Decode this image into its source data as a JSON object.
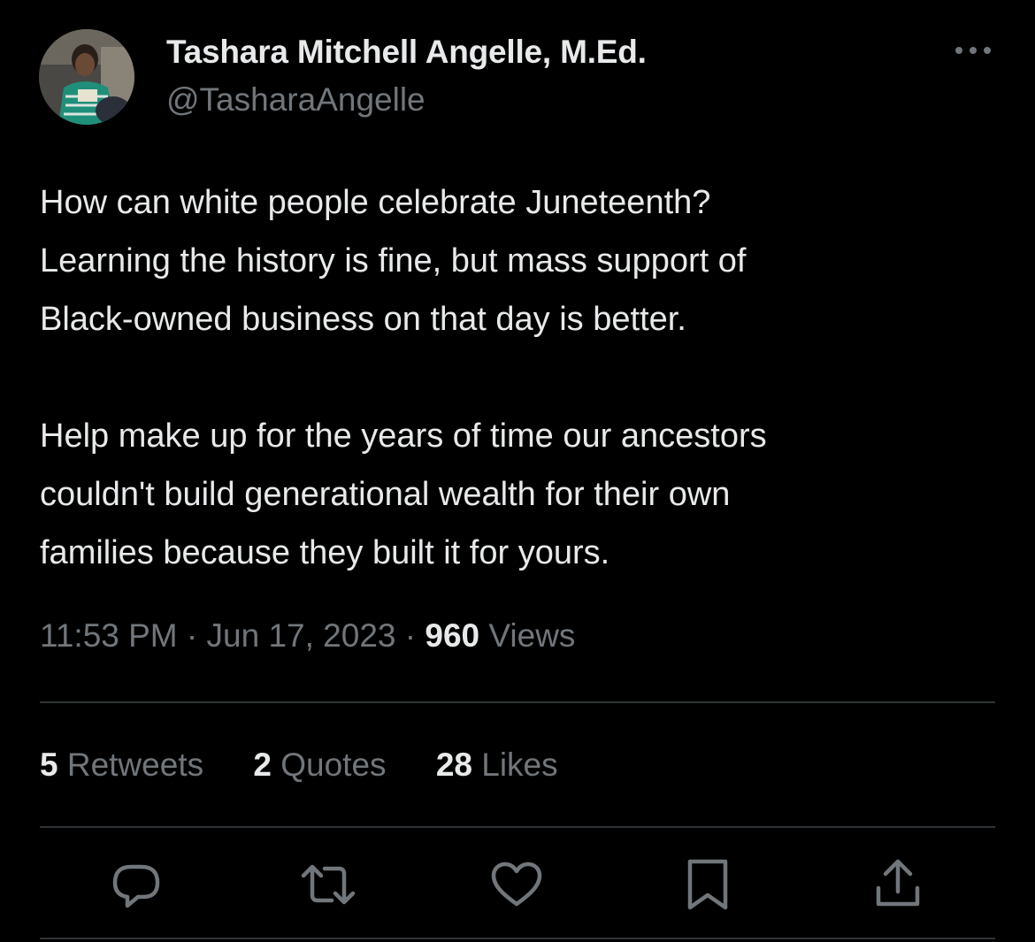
{
  "author": {
    "name": "Tashara Mitchell Angelle, M.Ed.",
    "handle": "@TasharaAngelle"
  },
  "tweet": {
    "paragraphs": [
      [
        "How can white people celebrate Juneteenth?",
        "Learning the history is fine, but mass support of",
        "Black-owned business on that day is better."
      ],
      [
        "Help make up for the years of time our ancestors",
        "couldn't build generational wealth for their own",
        "families because they built it for yours."
      ]
    ],
    "time": "11:53 PM",
    "separator": "·",
    "date": "Jun 17, 2023",
    "views_count": "960",
    "views_label": "Views"
  },
  "stats": {
    "retweets_count": "5",
    "retweets_label": "Retweets",
    "quotes_count": "2",
    "quotes_label": "Quotes",
    "likes_count": "28",
    "likes_label": "Likes"
  },
  "actions": [
    {
      "icon": "reply-icon"
    },
    {
      "icon": "retweet-icon"
    },
    {
      "icon": "like-icon"
    },
    {
      "icon": "bookmark-icon"
    },
    {
      "icon": "share-icon"
    }
  ],
  "colors": {
    "background": "#000000",
    "primary_text": "#e7e9ea",
    "secondary_text": "#71767b",
    "divider": "#2f3336"
  }
}
